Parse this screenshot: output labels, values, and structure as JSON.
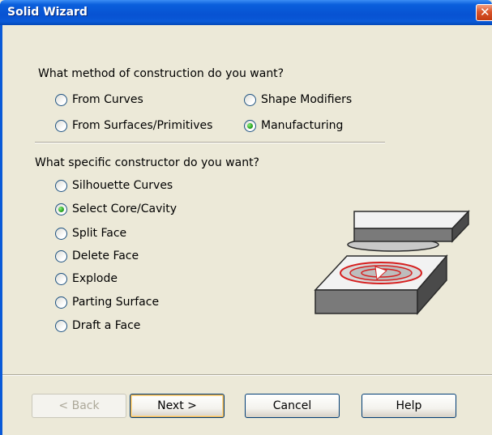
{
  "window": {
    "title": "Solid Wizard",
    "close_glyph": "✕"
  },
  "construction": {
    "question": "What method of construction do you want?",
    "options": [
      {
        "label": "From Curves",
        "selected": false
      },
      {
        "label": "Shape Modifiers",
        "selected": false
      },
      {
        "label": "From Surfaces/Primitives",
        "selected": false
      },
      {
        "label": "Manufacturing",
        "selected": true
      }
    ]
  },
  "constructor": {
    "question": "What specific constructor do you want?",
    "options": [
      {
        "label": "Silhouette Curves",
        "selected": false
      },
      {
        "label": "Select Core/Cavity",
        "selected": true
      },
      {
        "label": "Split Face",
        "selected": false
      },
      {
        "label": "Delete Face",
        "selected": false
      },
      {
        "label": "Explode",
        "selected": false
      },
      {
        "label": "Parting Surface",
        "selected": false
      },
      {
        "label": "Draft a Face",
        "selected": false
      }
    ]
  },
  "buttons": {
    "back": "< Back",
    "next": "Next >",
    "cancel": "Cancel",
    "help": "Help"
  },
  "illustration": {
    "icon": "core-cavity-mold-icon",
    "accent": "#d61f1f"
  },
  "colors": {
    "dialog_bg": "#ece9d8",
    "titlebar": "#0752d2",
    "radio_selected": "#2fa829"
  }
}
